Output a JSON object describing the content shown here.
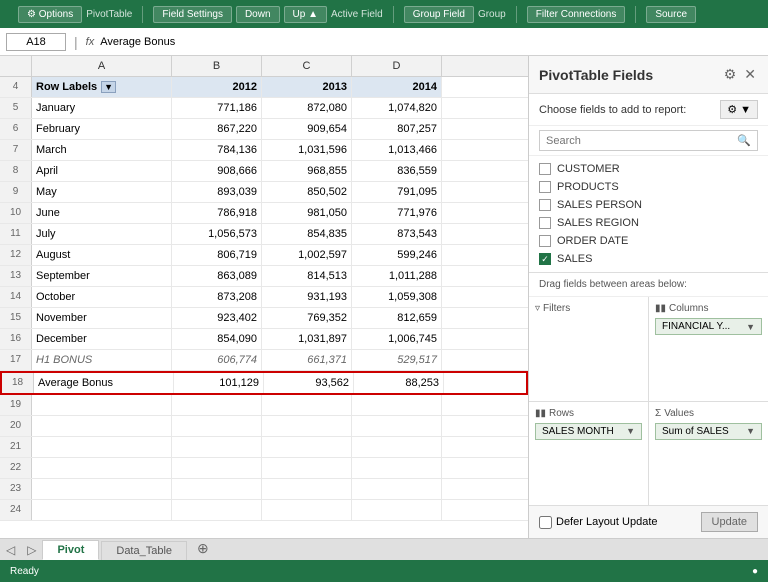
{
  "ribbon": {
    "sections": [
      {
        "name": "PivotTable",
        "buttons": [
          "Options"
        ],
        "label": "PivotTable"
      },
      {
        "name": "ActiveField",
        "buttons": [
          "Field Settings",
          "Down",
          "Up"
        ],
        "label": "Active Field",
        "field_value": "Average Bonus"
      },
      {
        "name": "Group",
        "buttons": [
          "Group Field"
        ],
        "label": "Group"
      },
      {
        "name": "FilterConnections",
        "buttons": [
          "Filter Connections"
        ],
        "label": ""
      },
      {
        "name": "Source",
        "buttons": [
          "Source"
        ],
        "label": "Source"
      }
    ]
  },
  "formula_bar": {
    "cell_ref": "A18",
    "formula": "Average Bonus",
    "fx": "fx"
  },
  "spreadsheet": {
    "columns": [
      "A",
      "B",
      "C",
      "D"
    ],
    "col_headers": [
      "",
      "2012",
      "2013",
      "2014"
    ],
    "rows": [
      {
        "num": "4",
        "a": "Row Labels",
        "b": "2012",
        "c": "2013",
        "d": "2014",
        "type": "header"
      },
      {
        "num": "5",
        "a": "January",
        "b": "771,186",
        "c": "872,080",
        "d": "1,074,820",
        "type": "data"
      },
      {
        "num": "6",
        "a": "February",
        "b": "867,220",
        "c": "909,654",
        "d": "807,257",
        "type": "data"
      },
      {
        "num": "7",
        "a": "March",
        "b": "784,136",
        "c": "1,031,596",
        "d": "1,013,466",
        "type": "data"
      },
      {
        "num": "8",
        "a": "April",
        "b": "908,666",
        "c": "968,855",
        "d": "836,559",
        "type": "data"
      },
      {
        "num": "9",
        "a": "May",
        "b": "893,039",
        "c": "850,502",
        "d": "791,095",
        "type": "data"
      },
      {
        "num": "10",
        "a": "June",
        "b": "786,918",
        "c": "981,050",
        "d": "771,976",
        "type": "data"
      },
      {
        "num": "11",
        "a": "July",
        "b": "1,056,573",
        "c": "854,835",
        "d": "873,543",
        "type": "data"
      },
      {
        "num": "12",
        "a": "August",
        "b": "806,719",
        "c": "1,002,597",
        "d": "599,246",
        "type": "data"
      },
      {
        "num": "13",
        "a": "September",
        "b": "863,089",
        "c": "814,513",
        "d": "1,011,288",
        "type": "data"
      },
      {
        "num": "14",
        "a": "October",
        "b": "873,208",
        "c": "931,193",
        "d": "1,059,308",
        "type": "data"
      },
      {
        "num": "15",
        "a": "November",
        "b": "923,402",
        "c": "769,352",
        "d": "812,659",
        "type": "data"
      },
      {
        "num": "16",
        "a": "December",
        "b": "854,090",
        "c": "1,031,897",
        "d": "1,006,745",
        "type": "data"
      },
      {
        "num": "17",
        "a": "H1 BONUS",
        "b": "606,774",
        "c": "661,371",
        "d": "529,517",
        "type": "h1bonus"
      },
      {
        "num": "18",
        "a": "Average Bonus",
        "b": "101,129",
        "c": "93,562",
        "d": "88,253",
        "type": "avgbonus"
      },
      {
        "num": "19",
        "a": "",
        "b": "",
        "c": "",
        "d": "",
        "type": "empty"
      },
      {
        "num": "20",
        "a": "",
        "b": "",
        "c": "",
        "d": "",
        "type": "empty"
      },
      {
        "num": "21",
        "a": "",
        "b": "",
        "c": "",
        "d": "",
        "type": "empty"
      },
      {
        "num": "22",
        "a": "",
        "b": "",
        "c": "",
        "d": "",
        "type": "empty"
      },
      {
        "num": "23",
        "a": "",
        "b": "",
        "c": "",
        "d": "",
        "type": "empty"
      },
      {
        "num": "24",
        "a": "",
        "b": "",
        "c": "",
        "d": "",
        "type": "empty"
      }
    ]
  },
  "pivot_panel": {
    "title": "PivotTable Fields",
    "choose_text": "Choose fields to add to report:",
    "search_placeholder": "Search",
    "fields": [
      {
        "name": "CUSTOMER",
        "checked": false
      },
      {
        "name": "PRODUCTS",
        "checked": false
      },
      {
        "name": "SALES PERSON",
        "checked": false
      },
      {
        "name": "SALES REGION",
        "checked": false
      },
      {
        "name": "ORDER DATE",
        "checked": false
      },
      {
        "name": "SALES",
        "checked": true
      }
    ],
    "drag_hint": "Drag fields between areas below:",
    "areas": {
      "filters": {
        "label": "Filters",
        "tags": []
      },
      "columns": {
        "label": "Columns",
        "tags": [
          "FINANCIAL Y..."
        ]
      },
      "rows": {
        "label": "Rows",
        "tags": [
          "SALES MONTH"
        ]
      },
      "values": {
        "label": "Values",
        "tags": [
          "Sum of SALES"
        ]
      }
    },
    "footer": {
      "defer_label": "Defer Layout Update",
      "update_label": "Update"
    }
  },
  "sheet_tabs": [
    {
      "name": "Pivot",
      "active": true
    },
    {
      "name": "Data_Table",
      "active": false
    }
  ],
  "status_bar": {
    "ready": "Ready"
  }
}
